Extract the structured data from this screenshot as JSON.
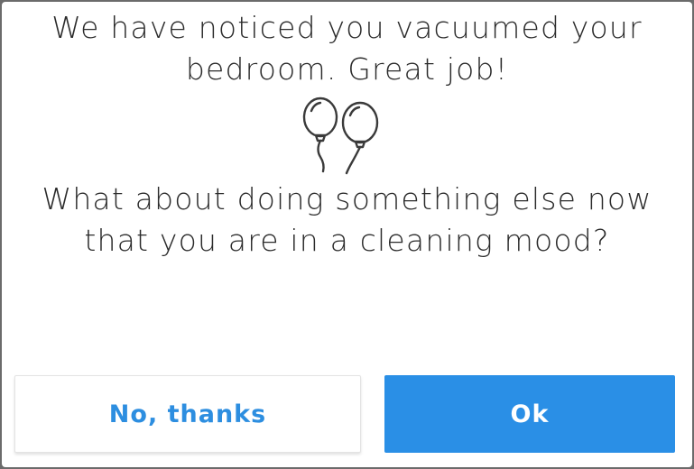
{
  "dialog": {
    "message_top": "We have noticed you vacuumed your\nbedroom. Great job!",
    "message_bottom": "What about doing something else now\nthat you are in a cleaning mood?",
    "icon": "balloons-icon",
    "buttons": {
      "secondary_label": "No, thanks",
      "primary_label": "Ok"
    }
  },
  "colors": {
    "accent": "#2a8fe6",
    "text": "#2b2b2b",
    "background": "#ffffff",
    "backdrop": "#6b6b6b"
  }
}
